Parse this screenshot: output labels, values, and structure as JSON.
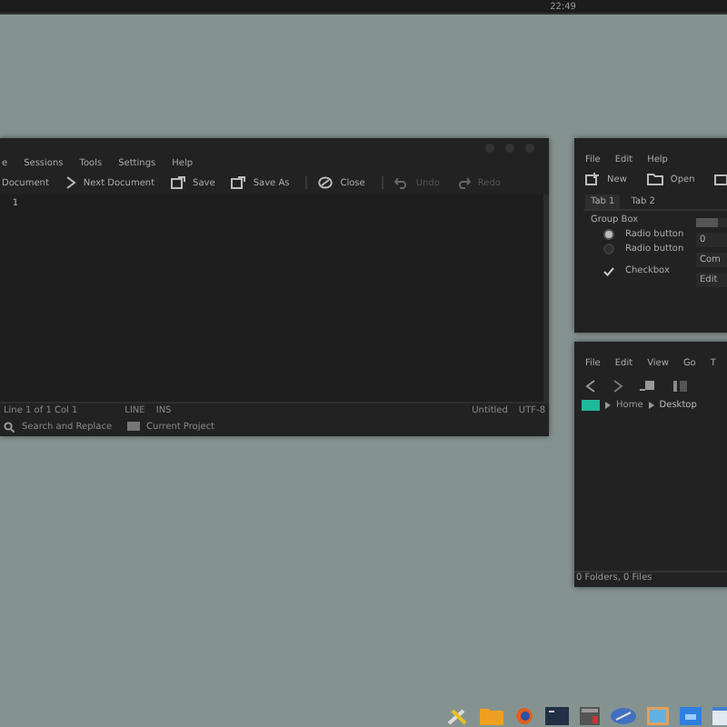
{
  "top_bar": {
    "clock": "22:49"
  },
  "editor": {
    "menu": [
      "e",
      "Sessions",
      "Tools",
      "Settings",
      "Help"
    ],
    "toolbar": [
      {
        "label": "Document",
        "kind": "prev",
        "disabled": false
      },
      {
        "label": "Next Document",
        "kind": "next",
        "disabled": false
      },
      {
        "label": "Save",
        "kind": "save",
        "disabled": false
      },
      {
        "label": "Save As",
        "kind": "saveas",
        "disabled": false
      },
      {
        "label": "Close",
        "kind": "close",
        "disabled": false
      },
      {
        "label": "Undo",
        "kind": "undo",
        "disabled": true
      },
      {
        "label": "Redo",
        "kind": "redo",
        "disabled": true
      }
    ],
    "line_numbers": [
      "1"
    ],
    "status_bar": {
      "position": "Line 1 of 1 Col 1",
      "mode": "LINE",
      "insert": "INS",
      "file": "Untitled",
      "encoding": "UTF-8"
    },
    "bottom_tabs": [
      {
        "label": "Search and Replace",
        "kind": "search"
      },
      {
        "label": "Current Project",
        "kind": "project"
      }
    ]
  },
  "widgets": {
    "menu": [
      "File",
      "Edit",
      "Help"
    ],
    "toolbar": [
      {
        "label": "New",
        "kind": "new"
      },
      {
        "label": "Open",
        "kind": "open"
      }
    ],
    "tabs": [
      {
        "label": "Tab 1",
        "selected": true
      },
      {
        "label": "Tab 2",
        "selected": false
      }
    ],
    "group_title": "Group Box",
    "radios": [
      {
        "label": "Radio button",
        "selected": true
      },
      {
        "label": "Radio button",
        "selected": false
      }
    ],
    "checkbox": {
      "label": "Checkbox",
      "checked": true
    },
    "slider": {
      "level": 0.6
    },
    "spin_value": "0",
    "combo_value": "Com",
    "edit_value": "Edit"
  },
  "file_manager": {
    "menu": [
      "File",
      "Edit",
      "View",
      "Go",
      "T"
    ],
    "breadcrumb": [
      "Home",
      "Desktop"
    ],
    "status": "0 Folders, 0 Files"
  },
  "dock": [
    {
      "kind": "tools"
    },
    {
      "kind": "folder"
    },
    {
      "kind": "browser"
    },
    {
      "kind": "terminal"
    },
    {
      "kind": "calculator"
    },
    {
      "kind": "disk"
    },
    {
      "kind": "image"
    },
    {
      "kind": "files"
    },
    {
      "kind": "window"
    }
  ]
}
